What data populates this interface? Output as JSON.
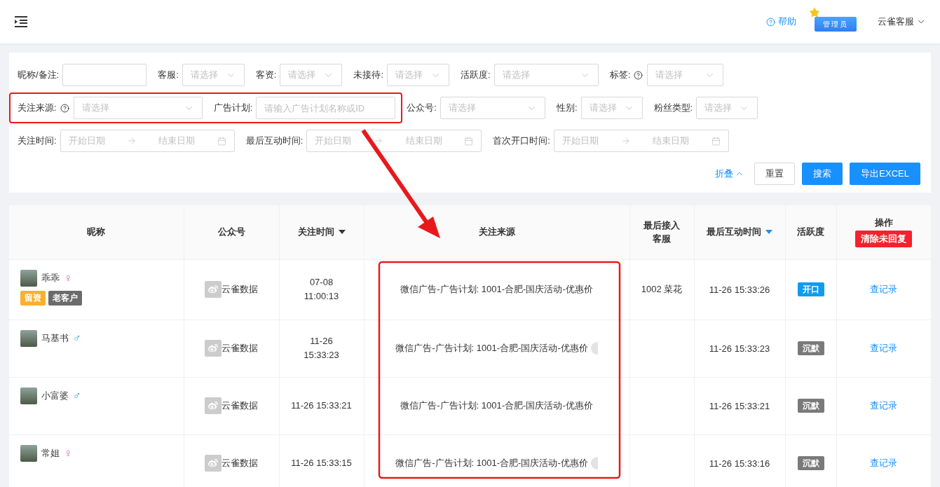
{
  "header": {
    "help": "帮助",
    "role_badge": "管理员",
    "user": "云雀客服"
  },
  "filters": [
    [
      {
        "kind": "input",
        "label": "昵称/备注:",
        "help": false
      },
      {
        "kind": "select",
        "label": "客服:",
        "help": false,
        "placeholder": "请选择"
      },
      {
        "kind": "select",
        "label": "客资:",
        "help": false,
        "placeholder": "请选择"
      },
      {
        "kind": "select",
        "label": "未接待:",
        "help": false,
        "placeholder": "请选择"
      },
      {
        "kind": "select",
        "label": "活跃度:",
        "help": false,
        "placeholder": "请选择"
      },
      {
        "kind": "select",
        "label": "标签:",
        "help": true,
        "placeholder": "请选择"
      }
    ],
    [
      {
        "kind": "select",
        "label": "关注来源:",
        "help": true,
        "placeholder": "请选择"
      },
      {
        "kind": "input",
        "label": "广告计划:",
        "help": false,
        "placeholder": "请输入广告计划名称或ID"
      },
      {
        "kind": "select",
        "label": "公众号:",
        "help": false,
        "placeholder": "请选择"
      },
      {
        "kind": "select",
        "label": "性别:",
        "help": false,
        "placeholder": "请选择"
      },
      {
        "kind": "select",
        "label": "粉丝类型:",
        "help": false,
        "placeholder": "请选择"
      }
    ],
    [
      {
        "kind": "date_range",
        "label": "关注时间:",
        "help": false,
        "placeholder": "开始日期",
        "end_placeholder": "结束日期"
      },
      {
        "kind": "date_range",
        "label": "最后互动时间:",
        "help": false,
        "placeholder": "开始日期",
        "end_placeholder": "结束日期"
      },
      {
        "kind": "date_range",
        "label": "首次开口时间:",
        "help": false,
        "placeholder": "开始日期",
        "end_placeholder": "结束日期"
      }
    ]
  ],
  "actions": {
    "collapse": "折叠",
    "reset": "重置",
    "search": "搜索",
    "export": "导出EXCEL"
  },
  "table": {
    "columns": [
      {
        "kind": "plain",
        "label": "昵称"
      },
      {
        "kind": "plain",
        "label": "公众号"
      },
      {
        "kind": "sort",
        "label": "关注时间",
        "sorted": false
      },
      {
        "kind": "plain",
        "label": "关注来源"
      },
      {
        "kind": "plain",
        "label": "最后接入客服"
      },
      {
        "kind": "sort",
        "label": "最后互动时间",
        "sorted": true
      },
      {
        "kind": "plain",
        "label": "活跃度"
      },
      {
        "kind": "action",
        "label": "操作",
        "button": "清除未回复"
      }
    ],
    "rows": [
      {
        "name": "乖乖",
        "gender": {
          "kind": "female",
          "sign": "♀"
        },
        "tags": [
          {
            "label": "留资",
            "color": "#fbb02d"
          },
          {
            "label": "老客户",
            "color": "#6b6b6b"
          }
        ],
        "account": "云雀数据",
        "follow_time": "07-08\n11:00:13",
        "source": "微信广告-广告计划: 1001-合肥-国庆活动-优惠价",
        "more_tag": false,
        "last_agent": "1002 菜花",
        "last_interaction": "11-26 15:33:26",
        "activity": {
          "label": "开口",
          "color": "#0d9cf2"
        },
        "action": "查记录"
      },
      {
        "name": "马基书",
        "gender": {
          "kind": "male",
          "sign": "♂"
        },
        "tags": [],
        "account": "云雀数据",
        "follow_time": "11-26\n15:33:23",
        "source": "微信广告-广告计划: 1001-合肥-国庆活动-优惠价",
        "more_tag": true,
        "last_interaction": "11-26 15:33:23",
        "activity": {
          "label": "沉默",
          "color": "#7a7a7a"
        },
        "action": "查记录"
      },
      {
        "name": "小富婆",
        "gender": {
          "kind": "male",
          "sign": "♂"
        },
        "tags": [],
        "account": "云雀数据",
        "follow_time": "11-26 15:33:21",
        "source": "微信广告-广告计划: 1001-合肥-国庆活动-优惠价",
        "more_tag": false,
        "last_interaction": "11-26 15:33:21",
        "activity": {
          "label": "沉默",
          "color": "#7a7a7a"
        },
        "action": "查记录"
      },
      {
        "name": "常姐",
        "gender": {
          "kind": "female",
          "sign": "♀"
        },
        "tags": [],
        "account": "云雀数据",
        "follow_time": "11-26 15:33:15",
        "source": "微信广告-广告计划: 1001-合肥-国庆活动-优惠价",
        "more_tag": true,
        "last_interaction": "11-26 15:33:16",
        "activity": {
          "label": "沉默",
          "color": "#7a7a7a"
        },
        "action": "查记录"
      }
    ]
  }
}
